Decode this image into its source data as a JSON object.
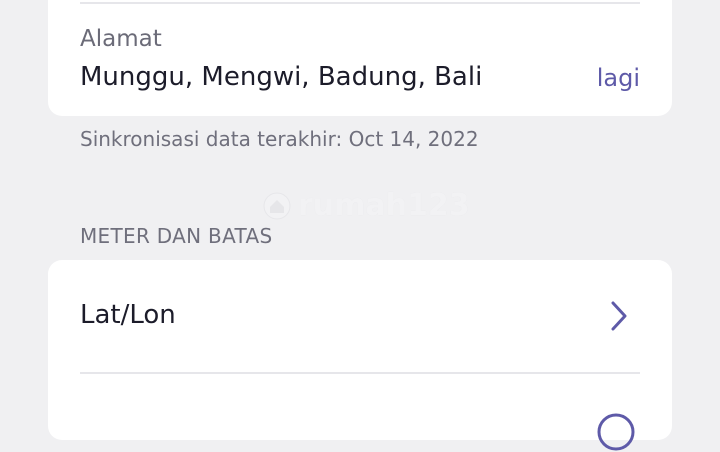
{
  "address_card": {
    "label": "Alamat",
    "value": "Munggu, Mengwi, Badung, Bali",
    "more_link": "lagi"
  },
  "sync": {
    "text": "Sinkronisasi data terakhir: Oct 14, 2022"
  },
  "watermark": {
    "text": "rumah123"
  },
  "meter_section": {
    "title": "METER DAN BATAS",
    "rows": [
      {
        "label": "Lat/Lon",
        "icon": "chevron-right-icon"
      }
    ],
    "partial_icon": "circle-icon"
  },
  "colors": {
    "accent": "#5e5aa8",
    "background": "#f0f0f2",
    "card": "#ffffff",
    "text_primary": "#1c1c2a",
    "text_secondary": "#6f6f7c"
  }
}
